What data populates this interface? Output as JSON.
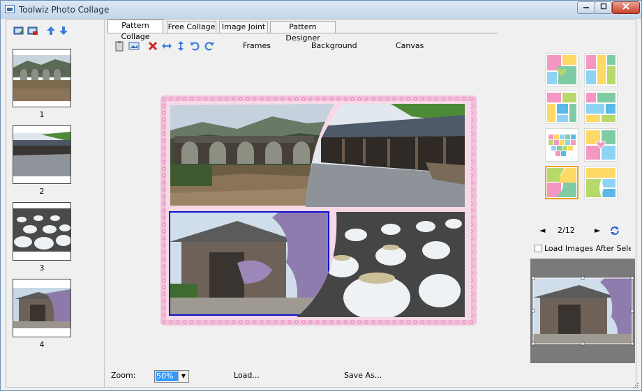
{
  "window": {
    "title": "Toolwiz Photo Collage"
  },
  "sidebar": {
    "tools": [
      "import-image-icon",
      "remove-image-icon",
      "arrow-up-icon",
      "arrow-down-icon"
    ],
    "thumbnails": [
      {
        "label": "1",
        "subject": "stone bridge"
      },
      {
        "label": "2",
        "subject": "long shed"
      },
      {
        "label": "3",
        "subject": "ceramic bowls"
      },
      {
        "label": "4",
        "subject": "temple with wisteria"
      }
    ]
  },
  "tabs": [
    "Pattern Collage",
    "Free Collage",
    "Image Joint",
    "Pattern Designer"
  ],
  "active_tab": "Pattern Collage",
  "toolbar": {
    "icons": [
      "clipboard-icon",
      "image-icon",
      "delete-icon",
      "flip-horizontal-icon",
      "flip-vertical-icon",
      "rotate-left-icon",
      "rotate-right-icon"
    ],
    "links": [
      "Frames",
      "Background",
      "Canvas"
    ]
  },
  "patterns": {
    "count": 8,
    "selected_index": 6
  },
  "pager": {
    "prev": "◄",
    "page": "2/12",
    "next": "►"
  },
  "load_images_label": "Load Images After Selectin",
  "bottom": {
    "zoom_label": "Zoom:",
    "zoom_value": "50%",
    "load_label": "Load...",
    "save_label": "Save As..."
  },
  "colors": {
    "frame_pink": "#f0b6d4",
    "selection_blue": "#1010d0",
    "pattern_selected": "#f0a020",
    "close_red": "#c7412b"
  }
}
